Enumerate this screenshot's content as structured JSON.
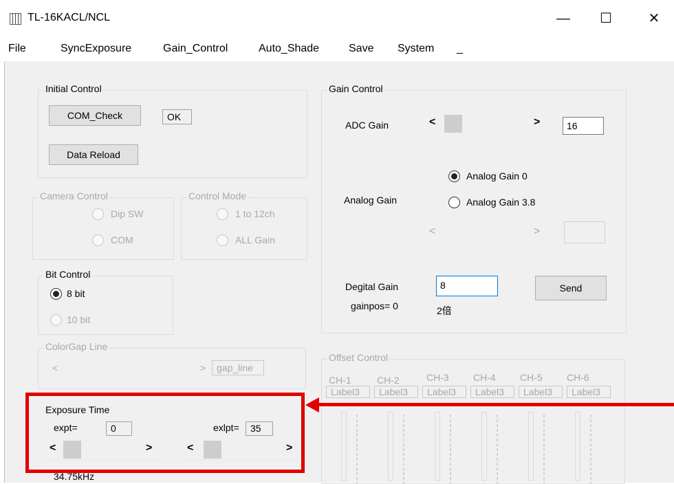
{
  "window": {
    "title": "TL-16KACL/NCL",
    "minimize": "—",
    "maximize": "☐",
    "close": "✕"
  },
  "menu": [
    "File",
    "SyncExposure",
    "Gain_Control",
    "Auto_Shade",
    "Save",
    "System",
    "_"
  ],
  "initial_control": {
    "title": "Initial Control",
    "com_check": "COM_Check",
    "status": "OK",
    "data_reload": "Data Reload"
  },
  "camera_control": {
    "title": "Camera Control",
    "dip_sw": "Dip SW",
    "com": "COM"
  },
  "control_mode": {
    "title": "Control Mode",
    "opt1": "1 to 12ch",
    "opt2": "ALL Gain"
  },
  "bit_control": {
    "title": "Bit Control",
    "opt1": "8 bit",
    "opt2": "10 bit"
  },
  "colorgap": {
    "title": "ColorGap Line",
    "value": "gap_line"
  },
  "exposure": {
    "title": "Exposure Time",
    "expt_label": "expt=",
    "expt_value": "0",
    "exlpt_label": "exlpt=",
    "exlpt_value": "35",
    "freq": "34.75kHz"
  },
  "gain_control": {
    "title": "Gain Control",
    "adc_label": "ADC Gain",
    "adc_value": "16",
    "analog_label": "Analog Gain",
    "analog_opt1": "Analog Gain 0",
    "analog_opt2": "Analog Gain 3.8",
    "digital_label": "Degital Gain",
    "digital_value": "8",
    "gainpos": "gainpos= 0",
    "multiplier": "2倍",
    "send": "Send"
  },
  "offset": {
    "title": "Offset Control",
    "channels": [
      "CH-1",
      "CH-2",
      "CH-3",
      "CH-4",
      "CH-5",
      "CH-6"
    ],
    "label": "Label3"
  },
  "arrows": {
    "left": "<",
    "right": ">"
  }
}
